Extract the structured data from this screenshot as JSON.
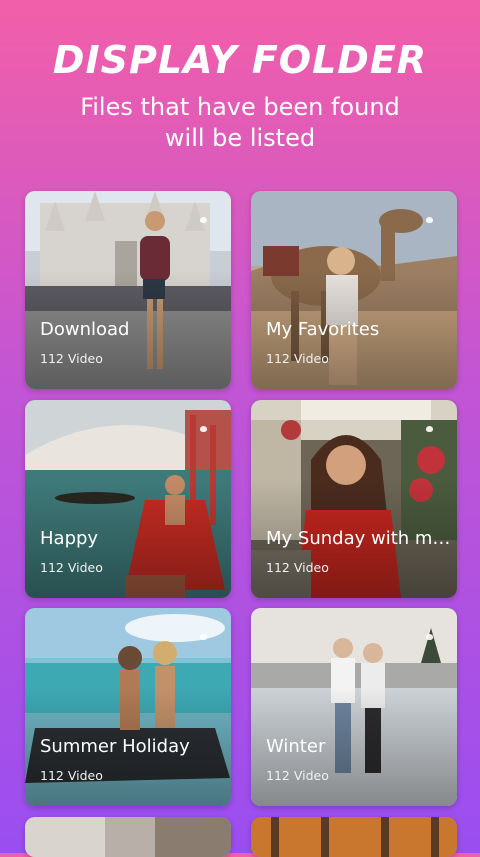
{
  "header": {
    "title": "DISPLAY FOLDER",
    "subtitle": "Files that have been found will be listed"
  },
  "folders": [
    {
      "name": "Download",
      "count": "112 Video",
      "icon": "video-marker-icon"
    },
    {
      "name": "My Favorites",
      "count": "112 Video",
      "icon": "video-marker-icon"
    },
    {
      "name": "Happy",
      "count": "112 Video",
      "icon": "video-marker-icon"
    },
    {
      "name": "My Sunday with my...",
      "count": "112 Video",
      "icon": "video-marker-icon"
    },
    {
      "name": "Summer Holiday",
      "count": "112 Video",
      "icon": "video-marker-icon"
    },
    {
      "name": "Winter",
      "count": "112 Video",
      "icon": "video-marker-icon"
    }
  ],
  "colors": {
    "gradient_top": "#f25fa8",
    "gradient_bottom": "#9a4ef0",
    "text": "#ffffff"
  }
}
